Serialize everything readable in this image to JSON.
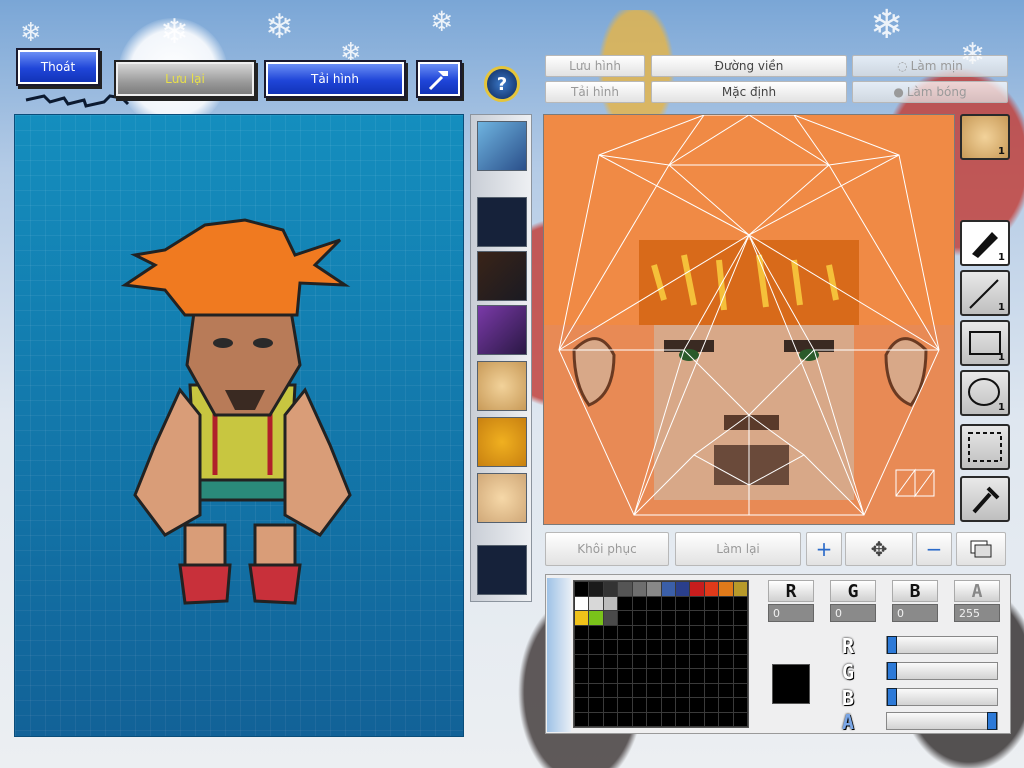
{
  "top_buttons": {
    "exit_label": "Thoát",
    "save_label": "Lưu lại",
    "reload_label": "Tải hình",
    "hammer_icon": "hammer-icon"
  },
  "help_icon": "question-mark-icon",
  "editor_tabs": {
    "save_image": "Lưu hình",
    "outline": "Đường viền",
    "smooth": "Làm mịn",
    "load_image": "Tải hình",
    "default": "Mặc định",
    "shade": "Làm bóng"
  },
  "tool_counts": {
    "portrait": "1",
    "pen": "1",
    "line": "1",
    "rect": "1",
    "ellipse": "1"
  },
  "bottom_buttons": {
    "restore": "Khôi phục",
    "redo": "Làm lại"
  },
  "color": {
    "channel_labels": [
      "R",
      "G",
      "B",
      "A"
    ],
    "r": "0",
    "g": "0",
    "b": "0",
    "a": "255",
    "slider_labels": [
      "R",
      "G",
      "B",
      "A"
    ],
    "slider_values": [
      0,
      0,
      0,
      255
    ],
    "current_color": "#000000",
    "palette": [
      "#000000",
      "#1a1a1a",
      "#333333",
      "#555555",
      "#6e6e6e",
      "#888888",
      "#3b5fa8",
      "#2a3f8c",
      "#c81d1d",
      "#e03a1a",
      "#e07a1a",
      "#b89a2a",
      "#ffffff",
      "#d8d8d8",
      "#bcbcbc",
      "#000000",
      "#000000",
      "#000000",
      "#000000",
      "#000000",
      "#000000",
      "#000000",
      "#000000",
      "#000000",
      "#f0c21a",
      "#7ac21a",
      "#4a4a4a"
    ]
  }
}
